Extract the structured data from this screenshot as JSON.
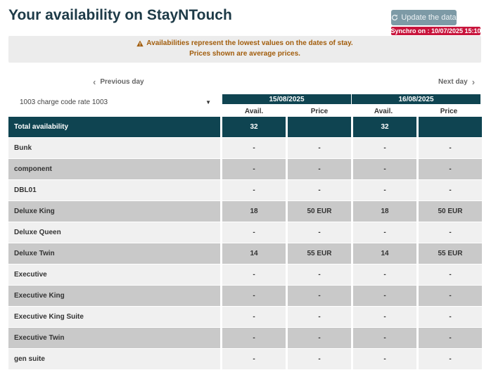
{
  "header": {
    "title": "Your availability on StayNTouch",
    "update_button": "Update the data",
    "synchro": "Synchro on : 10/07/2025 15:10"
  },
  "notice": {
    "line1": "Availabilities represent the lowest values on the dates of stay.",
    "line2": "Prices shown are average prices."
  },
  "nav": {
    "previous": "Previous day",
    "next": "Next day"
  },
  "rate_select": {
    "selected": "1003 charge code rate 1003"
  },
  "columns": {
    "dates": [
      "15/08/2025",
      "16/08/2025"
    ],
    "avail_label": "Avail.",
    "price_label": "Price"
  },
  "rows": [
    {
      "name": "Total availability",
      "cells": [
        "32",
        "",
        "32",
        ""
      ]
    },
    {
      "name": "Bunk",
      "cells": [
        "-",
        "-",
        "-",
        "-"
      ]
    },
    {
      "name": "component",
      "cells": [
        "-",
        "-",
        "-",
        "-"
      ]
    },
    {
      "name": "DBL01",
      "cells": [
        "-",
        "-",
        "-",
        "-"
      ]
    },
    {
      "name": "Deluxe King",
      "cells": [
        "18",
        "50 EUR",
        "18",
        "50 EUR"
      ]
    },
    {
      "name": "Deluxe Queen",
      "cells": [
        "-",
        "-",
        "-",
        "-"
      ]
    },
    {
      "name": "Deluxe Twin",
      "cells": [
        "14",
        "55 EUR",
        "14",
        "55 EUR"
      ]
    },
    {
      "name": "Executive",
      "cells": [
        "-",
        "-",
        "-",
        "-"
      ]
    },
    {
      "name": "Executive King",
      "cells": [
        "-",
        "-",
        "-",
        "-"
      ]
    },
    {
      "name": "Executive King Suite",
      "cells": [
        "-",
        "-",
        "-",
        "-"
      ]
    },
    {
      "name": "Executive Twin",
      "cells": [
        "-",
        "-",
        "-",
        "-"
      ]
    },
    {
      "name": "gen suite",
      "cells": [
        "-",
        "-",
        "-",
        "-"
      ]
    }
  ],
  "colors": {
    "header_teal": "#0f4451",
    "warning": "#a15c0b",
    "synchro_red": "#c8143c",
    "button": "#7d9aa6"
  },
  "icons": {
    "update": "refresh-icon",
    "warning": "warning-icon",
    "prev": "chevron-left-icon",
    "next": "chevron-right-icon",
    "select": "caret-down-icon"
  }
}
